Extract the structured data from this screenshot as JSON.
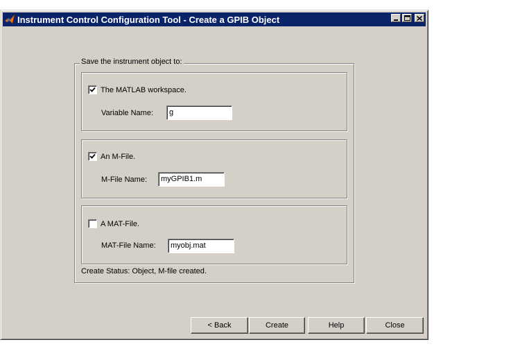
{
  "window": {
    "title": "Instrument Control Configuration Tool - Create a GPIB Object",
    "title_bar_color": "#0a246a",
    "face_color": "#d4d0c8",
    "icons": [
      "matlab-logo-icon",
      "minimize-icon",
      "maximize-icon",
      "close-icon"
    ]
  },
  "group": {
    "legend": "Save the instrument object to:"
  },
  "workspace": {
    "checkbox_label": "The MATLAB workspace.",
    "checked": true,
    "field_label": "Variable Name:",
    "field_value": "g"
  },
  "mfile": {
    "checkbox_label": "An M-File.",
    "checked": true,
    "field_label": "M-File Name:",
    "field_value": "myGPIB1.m"
  },
  "matfile": {
    "checkbox_label": "A MAT-File.",
    "checked": false,
    "field_label": "MAT-File Name:",
    "field_value": "myobj.mat"
  },
  "status": {
    "text": "Create Status: Object, M-file created."
  },
  "buttons": {
    "back": "< Back",
    "create": "Create",
    "help": "Help",
    "close": "Close"
  }
}
